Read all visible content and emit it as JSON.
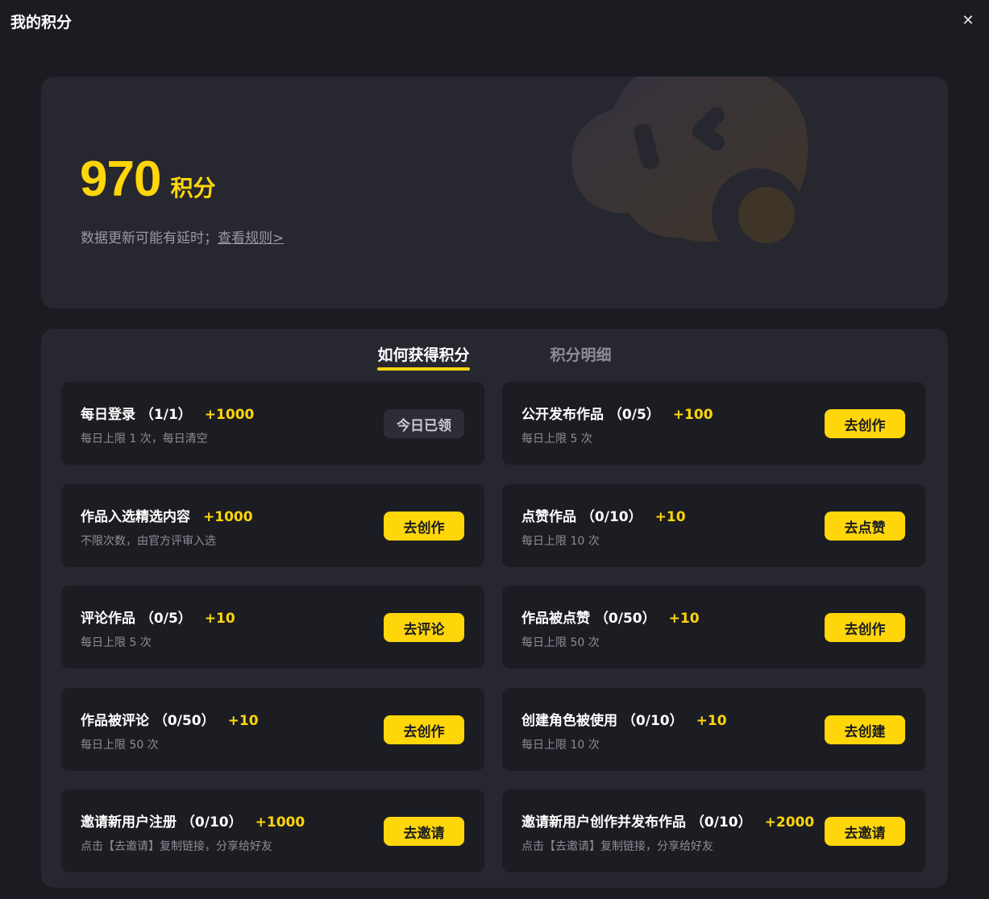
{
  "header": {
    "title": "我的积分",
    "close_icon": "close-icon"
  },
  "summary": {
    "points": "970",
    "unit": "积分",
    "hint": "数据更新可能有延时；",
    "rules_link": "查看规则>"
  },
  "tabs": [
    {
      "label": "如何获得积分",
      "active": true
    },
    {
      "label": "积分明细",
      "active": false
    }
  ],
  "tasks": [
    {
      "name": "每日登录 （1/1）",
      "reward": "+1000",
      "desc": "每日上限 1 次，每日清空",
      "button": "今日已领",
      "done": true
    },
    {
      "name": "公开发布作品 （0/5）",
      "reward": "+100",
      "desc": "每日上限 5 次",
      "button": "去创作",
      "done": false
    },
    {
      "name": "作品入选精选内容",
      "reward": "+1000",
      "desc": "不限次数，由官方评审入选",
      "button": "去创作",
      "done": false
    },
    {
      "name": "点赞作品 （0/10）",
      "reward": "+10",
      "desc": "每日上限 10 次",
      "button": "去点赞",
      "done": false
    },
    {
      "name": "评论作品 （0/5）",
      "reward": "+10",
      "desc": "每日上限 5 次",
      "button": "去评论",
      "done": false
    },
    {
      "name": "作品被点赞 （0/50）",
      "reward": "+10",
      "desc": "每日上限 50 次",
      "button": "去创作",
      "done": false
    },
    {
      "name": "作品被评论 （0/50）",
      "reward": "+10",
      "desc": "每日上限 50 次",
      "button": "去创作",
      "done": false
    },
    {
      "name": "创建角色被使用 （0/10）",
      "reward": "+10",
      "desc": "每日上限 10 次",
      "button": "去创建",
      "done": false
    },
    {
      "name": "邀请新用户注册 （0/10）",
      "reward": "+1000",
      "desc": "点击【去邀请】复制链接，分享给好友",
      "button": "去邀请",
      "done": false
    },
    {
      "name": "邀请新用户创作并发布作品 （0/10）",
      "reward": "+2000",
      "desc": "点击【去邀请】复制链接，分享给好友",
      "button": "去邀请",
      "done": false
    }
  ],
  "colors": {
    "accent": "#ffd60a",
    "background": "#1b1c22",
    "card": "#1c1d23",
    "panel": "#26272f"
  }
}
